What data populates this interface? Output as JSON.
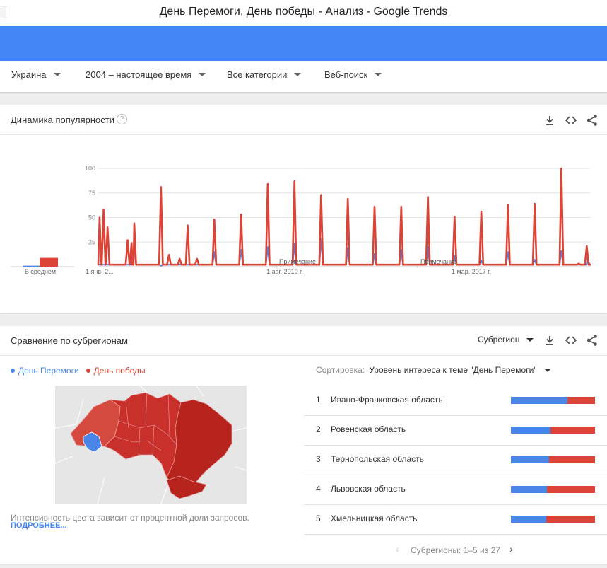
{
  "window": {
    "title": "День Перемоги, День победы - Анализ - Google Trends"
  },
  "filters": [
    {
      "label": "Украина"
    },
    {
      "label": "2004 – настоящее время"
    },
    {
      "label": "Все категории"
    },
    {
      "label": "Веб-поиск"
    }
  ],
  "interest": {
    "title": "Динамика популярности",
    "help": "?",
    "average_label": "В среднем",
    "note_label": "Примечание",
    "average": {
      "blue": 1,
      "red": 9
    }
  },
  "chart_data": {
    "type": "line",
    "title": "",
    "xlabel": "",
    "ylabel": "",
    "ylim": [
      0,
      100
    ],
    "yticks": [
      25,
      50,
      75,
      100
    ],
    "xticks": [
      "1 янв. 2...",
      "1 авг. 2010 г.",
      "1 мар. 2017 г."
    ],
    "series": [
      {
        "name": "День Перемоги",
        "color": "#4a86e8",
        "peaks": [
          [
            2005.35,
            22
          ],
          [
            2006.35,
            1
          ],
          [
            2007.35,
            2
          ],
          [
            2008.35,
            15
          ],
          [
            2009.35,
            17
          ],
          [
            2010.35,
            20
          ],
          [
            2011.35,
            23
          ],
          [
            2012.35,
            28
          ],
          [
            2013.35,
            19
          ],
          [
            2014.35,
            13
          ],
          [
            2015.35,
            17
          ],
          [
            2016.35,
            20
          ],
          [
            2017.35,
            11
          ],
          [
            2018.35,
            6
          ],
          [
            2019.35,
            15
          ],
          [
            2020.35,
            7
          ],
          [
            2021.35,
            16
          ],
          [
            2022.35,
            6
          ]
        ]
      },
      {
        "name": "День победы",
        "color": "#db4437",
        "peaks": [
          [
            2004.05,
            50
          ],
          [
            2004.2,
            58
          ],
          [
            2004.35,
            40
          ],
          [
            2005.1,
            27
          ],
          [
            2005.25,
            24
          ],
          [
            2005.35,
            44
          ],
          [
            2006.35,
            81
          ],
          [
            2006.65,
            12
          ],
          [
            2007.05,
            8
          ],
          [
            2007.35,
            42
          ],
          [
            2007.7,
            8
          ],
          [
            2008.35,
            48
          ],
          [
            2009.35,
            53
          ],
          [
            2010.35,
            84
          ],
          [
            2011.35,
            87
          ],
          [
            2012.35,
            73
          ],
          [
            2013.35,
            69
          ],
          [
            2014.35,
            61
          ],
          [
            2015.35,
            61
          ],
          [
            2016.35,
            71
          ],
          [
            2017.35,
            51
          ],
          [
            2018.35,
            56
          ],
          [
            2019.35,
            63
          ],
          [
            2020.35,
            64
          ],
          [
            2021.35,
            100
          ],
          [
            2022.0,
            3
          ],
          [
            2022.3,
            21
          ]
        ]
      }
    ]
  },
  "regions": {
    "title": "Сравнение по субрегионам",
    "scope_label": "Субрегион",
    "legend": [
      {
        "name": "День Перемоги",
        "color": "#4a86e8"
      },
      {
        "name": "День победы",
        "color": "#db4437"
      }
    ],
    "sort_label": "Сортировка:",
    "sort_value": "Уровень интереса к теме \"День Перемоги\"",
    "rows": [
      {
        "rank": "1",
        "name": "Ивано-Франковская область",
        "blue": 0.67
      },
      {
        "rank": "2",
        "name": "Ровенская область",
        "blue": 0.47
      },
      {
        "rank": "3",
        "name": "Тернопольская область",
        "blue": 0.45
      },
      {
        "rank": "4",
        "name": "Львовская область",
        "blue": 0.43
      },
      {
        "rank": "5",
        "name": "Хмельницкая область",
        "blue": 0.42
      }
    ],
    "color_hint": "Интенсивность цвета зависит от процентной доли запросов.",
    "more_link": "ПОДРОБНЕЕ...",
    "pagination": "Субрегионы: 1–5 из 27",
    "prev": "‹",
    "next": "›"
  }
}
